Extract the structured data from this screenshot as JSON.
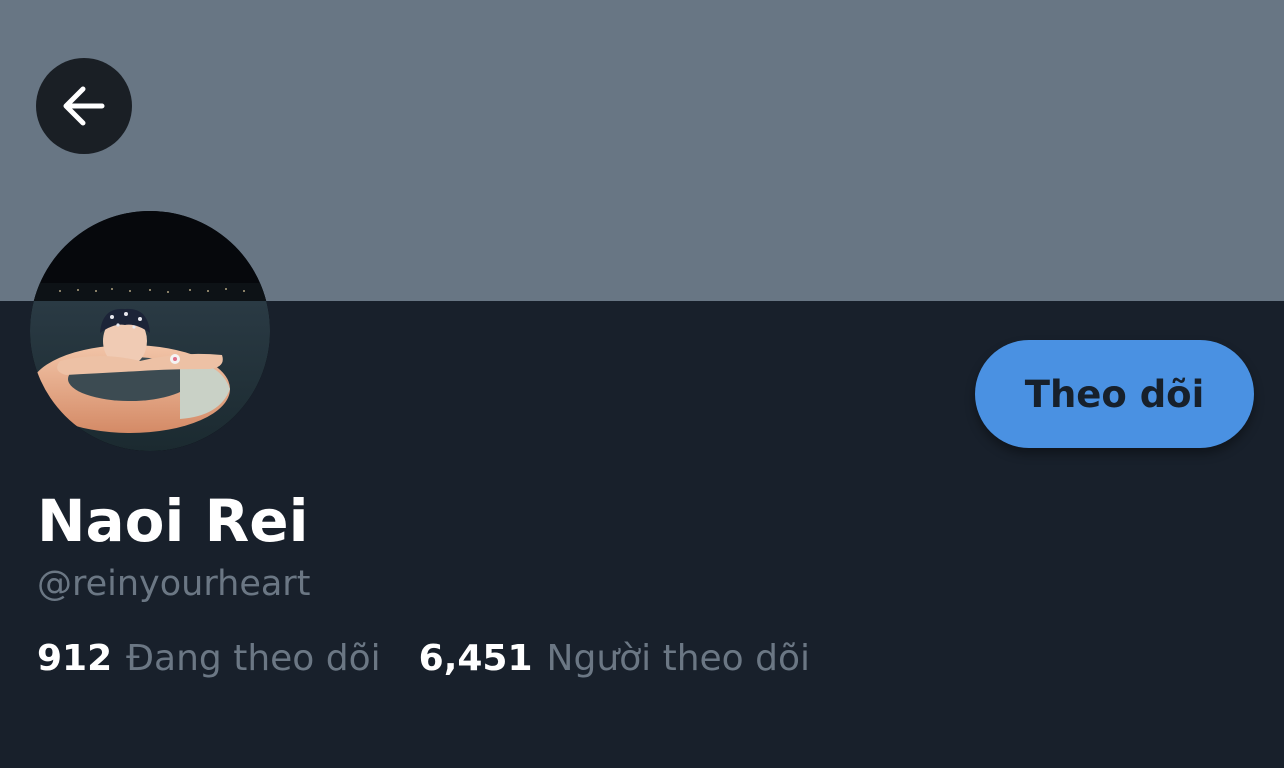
{
  "profile": {
    "display_name": "Naoi Rei",
    "handle": "@reinyourheart"
  },
  "actions": {
    "follow_label": "Theo dõi",
    "back_icon": "arrow-left-icon"
  },
  "stats": {
    "following": {
      "count": "912",
      "label": "Đang theo dõi"
    },
    "followers": {
      "count": "6,451",
      "label": "Người theo dõi"
    }
  },
  "colors": {
    "banner": "#687684",
    "background": "#18202b",
    "accent": "#4a91e2",
    "muted_text": "#6b7784"
  }
}
